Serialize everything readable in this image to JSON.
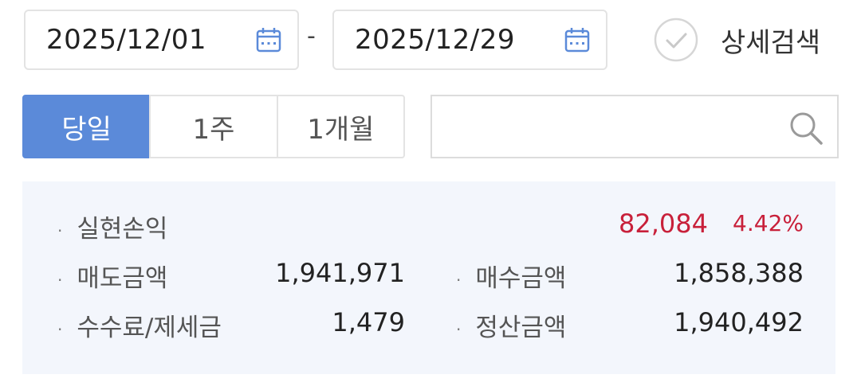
{
  "date_range": {
    "start": "2025/12/01",
    "separator": "-",
    "end": "2025/12/29"
  },
  "detail_search": {
    "label": "상세검색",
    "checked": false
  },
  "period_tabs": [
    {
      "label": "당일",
      "active": true
    },
    {
      "label": "1주",
      "active": false
    },
    {
      "label": "1개월",
      "active": false
    }
  ],
  "search": {
    "value": ""
  },
  "summary": {
    "realized_pnl": {
      "label": "실현손익",
      "value": "82,084",
      "rate": "4.42%"
    },
    "sell_amount": {
      "label": "매도금액",
      "value": "1,941,971"
    },
    "buy_amount": {
      "label": "매수금액",
      "value": "1,858,388"
    },
    "fees_taxes": {
      "label": "수수료/제세금",
      "value": "1,479"
    },
    "settlement_amount": {
      "label": "정산금액",
      "value": "1,940,492"
    }
  },
  "colors": {
    "accent": "#5b8ad9",
    "profit": "#c8203a",
    "summary_bg": "#f3f6fc",
    "calendar_icon": "#5b8ad9"
  }
}
